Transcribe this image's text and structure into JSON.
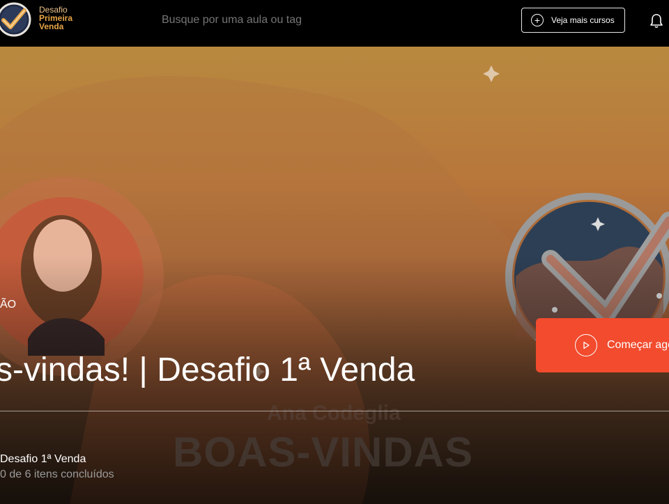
{
  "header": {
    "brand_lines": [
      "Desafio",
      "Primeira",
      "Venda"
    ],
    "search_placeholder": "Busque por uma aula ou tag",
    "more_courses_label": "Veja mais cursos"
  },
  "hero": {
    "kicker": "ÃO",
    "title": "s-vindas! | Desafio 1ª Venda",
    "cta_label": "Começar agora",
    "course_name": "Desafio 1ª Venda",
    "progress_text": "0 de 6 itens concluídos",
    "watermark_name": "Ana Codeglia",
    "watermark_title": "BOAS-VINDAS"
  },
  "colors": {
    "accent": "#f24b2e",
    "brand_orange": "#e8a546",
    "topbar": "#000000"
  }
}
